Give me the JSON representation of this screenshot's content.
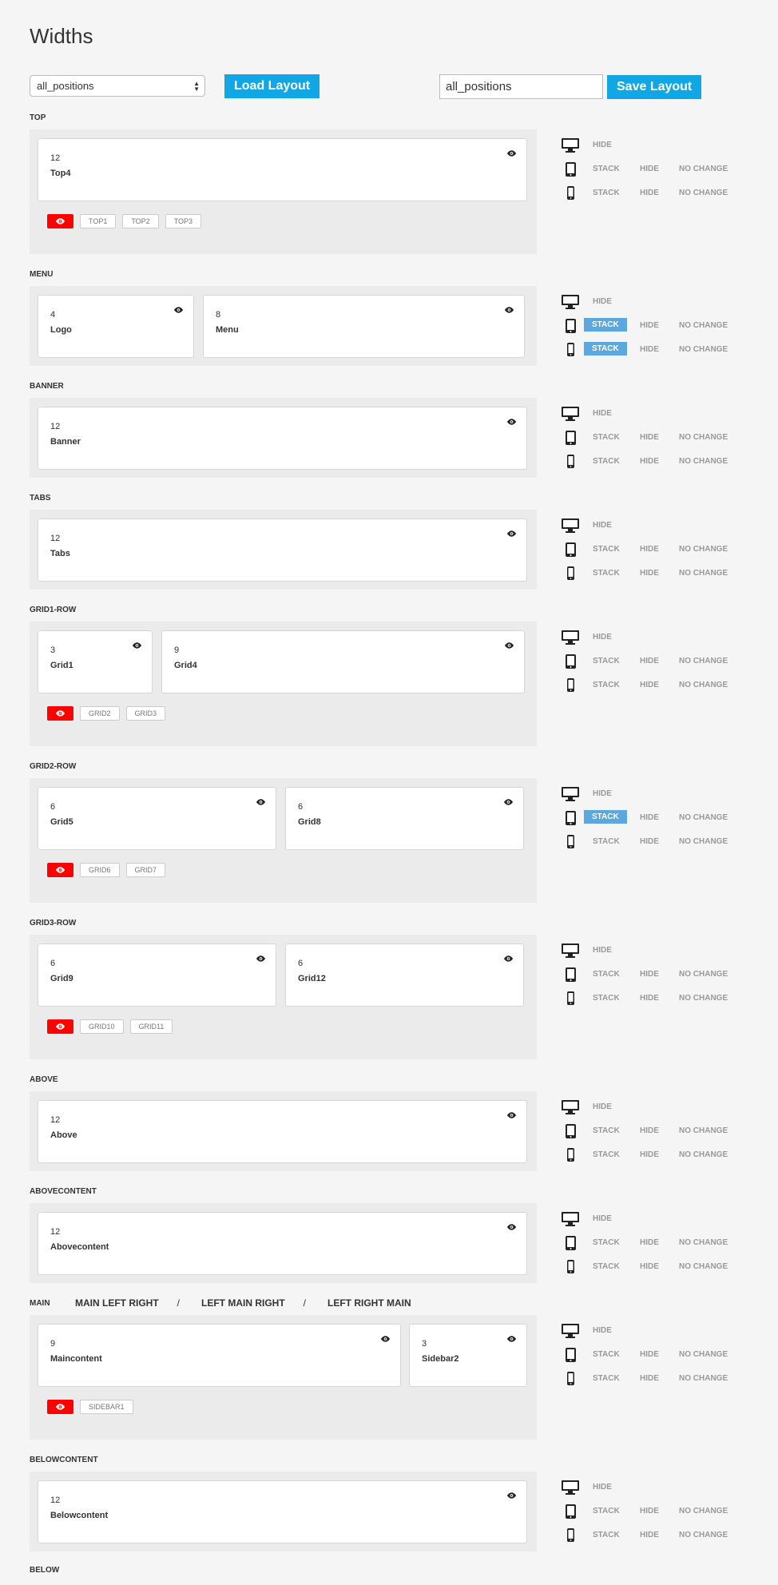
{
  "page": {
    "title": "Widths"
  },
  "toolbar": {
    "layout_select": "all_positions",
    "load_label": "Load Layout",
    "layout_name_value": "all_positions",
    "save_label": "Save Layout"
  },
  "labels": {
    "hide": "HIDE",
    "stack": "STACK",
    "no_change": "NO CHANGE"
  },
  "colors": {
    "accent": "#11a7e4",
    "active_option": "#5ba7e0",
    "hidden_toggle": "#ff0000"
  },
  "main_options": [
    "MAIN LEFT RIGHT",
    "/",
    "LEFT MAIN RIGHT",
    "/",
    "LEFT RIGHT MAIN"
  ],
  "sections": [
    {
      "label": "TOP",
      "cells": [
        {
          "width": "12",
          "name": "Top4"
        }
      ],
      "hidden": [
        "TOP1",
        "TOP2",
        "TOP3"
      ],
      "tablet": "none",
      "phone": "none"
    },
    {
      "label": "MENU",
      "cells": [
        {
          "width": "4",
          "name": "Logo"
        },
        {
          "width": "8",
          "name": "Menu"
        }
      ],
      "hidden": [],
      "tablet": "stack",
      "phone": "stack"
    },
    {
      "label": "BANNER",
      "cells": [
        {
          "width": "12",
          "name": "Banner"
        }
      ],
      "hidden": [],
      "tablet": "none",
      "phone": "none"
    },
    {
      "label": "TABS",
      "cells": [
        {
          "width": "12",
          "name": "Tabs"
        }
      ],
      "hidden": [],
      "tablet": "none",
      "phone": "none"
    },
    {
      "label": "GRID1-ROW",
      "cells": [
        {
          "width": "3",
          "name": "Grid1"
        },
        {
          "width": "9",
          "name": "Grid4"
        }
      ],
      "hidden": [
        "GRID2",
        "GRID3"
      ],
      "tablet": "none",
      "phone": "none"
    },
    {
      "label": "GRID2-ROW",
      "cells": [
        {
          "width": "6",
          "name": "Grid5"
        },
        {
          "width": "6",
          "name": "Grid8"
        }
      ],
      "hidden": [
        "GRID6",
        "GRID7"
      ],
      "tablet": "stack",
      "phone": "none"
    },
    {
      "label": "GRID3-ROW",
      "cells": [
        {
          "width": "6",
          "name": "Grid9"
        },
        {
          "width": "6",
          "name": "Grid12"
        }
      ],
      "hidden": [
        "GRID10",
        "GRID11"
      ],
      "tablet": "none",
      "phone": "none"
    },
    {
      "label": "ABOVE",
      "cells": [
        {
          "width": "12",
          "name": "Above"
        }
      ],
      "hidden": [],
      "tablet": "none",
      "phone": "none"
    },
    {
      "label": "ABOVECONTENT",
      "cells": [
        {
          "width": "12",
          "name": "Abovecontent"
        }
      ],
      "hidden": [],
      "tablet": "none",
      "phone": "none"
    },
    {
      "label": "MAIN",
      "cells": [
        {
          "width": "9",
          "name": "Maincontent"
        },
        {
          "width": "3",
          "name": "Sidebar2"
        }
      ],
      "hidden": [
        "SIDEBAR1"
      ],
      "tablet": "none",
      "phone": "none"
    },
    {
      "label": "BELOWCONTENT",
      "cells": [
        {
          "width": "12",
          "name": "Belowcontent"
        }
      ],
      "hidden": [],
      "tablet": "none",
      "phone": "none"
    },
    {
      "label": "BELOW",
      "cells": [],
      "hidden": [],
      "tablet": "none",
      "phone": "none"
    }
  ]
}
